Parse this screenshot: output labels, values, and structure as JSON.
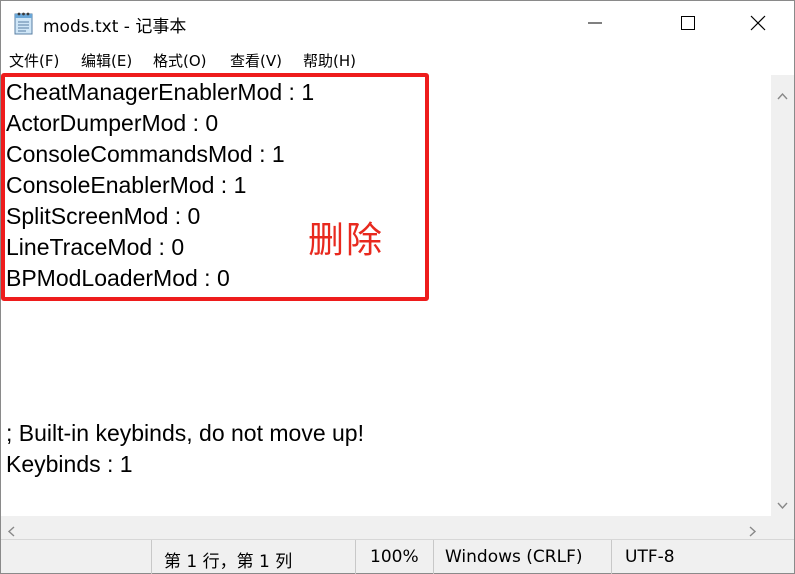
{
  "window": {
    "title": "mods.txt - 记事本"
  },
  "menu": {
    "file": "文件(F)",
    "edit": "编辑(E)",
    "format": "格式(O)",
    "view": "查看(V)",
    "help": "帮助(H)"
  },
  "editor": {
    "lines": [
      "CheatManagerEnablerMod : 1",
      "ActorDumperMod : 0",
      "ConsoleCommandsMod : 1",
      "ConsoleEnablerMod : 1",
      "SplitScreenMod : 0",
      "LineTraceMod : 0",
      "BPModLoaderMod : 0",
      "; Built-in keybinds, do not move up!",
      "Keybinds : 1"
    ],
    "annotation": "删除",
    "annotation_color": "#e8291e"
  },
  "status": {
    "position": "第 1 行，第 1 列",
    "zoom": "100%",
    "line_ending": "Windows (CRLF)",
    "encoding": "UTF-8"
  },
  "icons": {
    "app": "notepad-icon",
    "minimize": "minimize-icon",
    "maximize": "maximize-icon",
    "close": "close-icon"
  }
}
